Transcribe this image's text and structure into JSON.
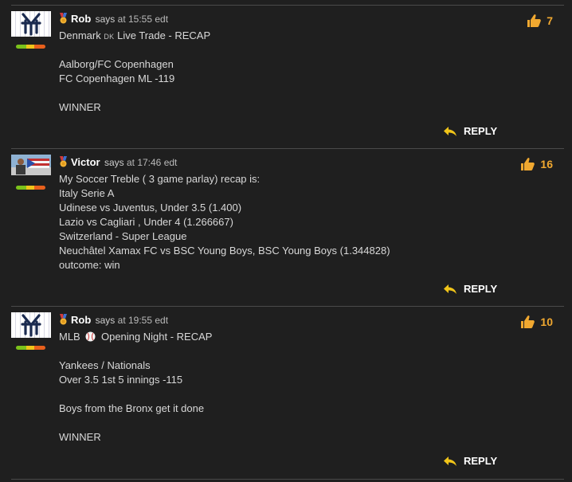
{
  "comments": [
    {
      "author": "Rob",
      "says_text": "says",
      "time_text": "at 15:55 edt",
      "likes": "7",
      "avatar": "yankees-logo-avatar",
      "rep_colors": [
        "#7cc21b",
        "#f0c419",
        "#e8601c"
      ],
      "lines": [
        "Denmark",
        "DK",
        "Live Trade - RECAP",
        "",
        "Aalborg/FC Copenhagen",
        "FC Copenhagen ML -119",
        "",
        "WINNER"
      ],
      "reply_label": "REPLY"
    },
    {
      "author": "Victor",
      "says_text": "says",
      "time_text": "at 17:46 edt",
      "likes": "16",
      "avatar": "photo-avatar",
      "rep_colors": [
        "#7cc21b",
        "#f0c419",
        "#e8601c"
      ],
      "lines": [
        "My Soccer Treble ( 3 game parlay) recap is:",
        "Italy Serie A",
        "Udinese vs Juventus, Under 3.5 (1.400)",
        "Lazio vs Cagliari , Under 4 (1.266667)",
        "Switzerland - Super League",
        "Neuchâtel Xamax FC vs BSC Young Boys, BSC Young Boys (1.344828)",
        "outcome: win"
      ],
      "reply_label": "REPLY"
    },
    {
      "author": "Rob",
      "says_text": "says",
      "time_text": "at 19:55 edt",
      "likes": "10",
      "avatar": "yankees-logo-avatar",
      "rep_colors": [
        "#7cc21b",
        "#f0c419",
        "#e8601c"
      ],
      "lines": [
        "MLB",
        "Opening Night - RECAP",
        "",
        "Yankees / Nationals",
        "Over 3.5 1st 5 innings -115",
        "",
        "Boys from the Bronx get it done",
        "",
        "WINNER"
      ],
      "reply_label": "REPLY"
    }
  ],
  "colors": {
    "accent": "#f0a830",
    "background": "#1f1f1f",
    "divider": "#4a4a4a"
  },
  "icons": {
    "like": "thumbs-up-icon",
    "reply": "reply-arrow-icon",
    "medal": "medal-icon",
    "baseball": "baseball-icon"
  }
}
